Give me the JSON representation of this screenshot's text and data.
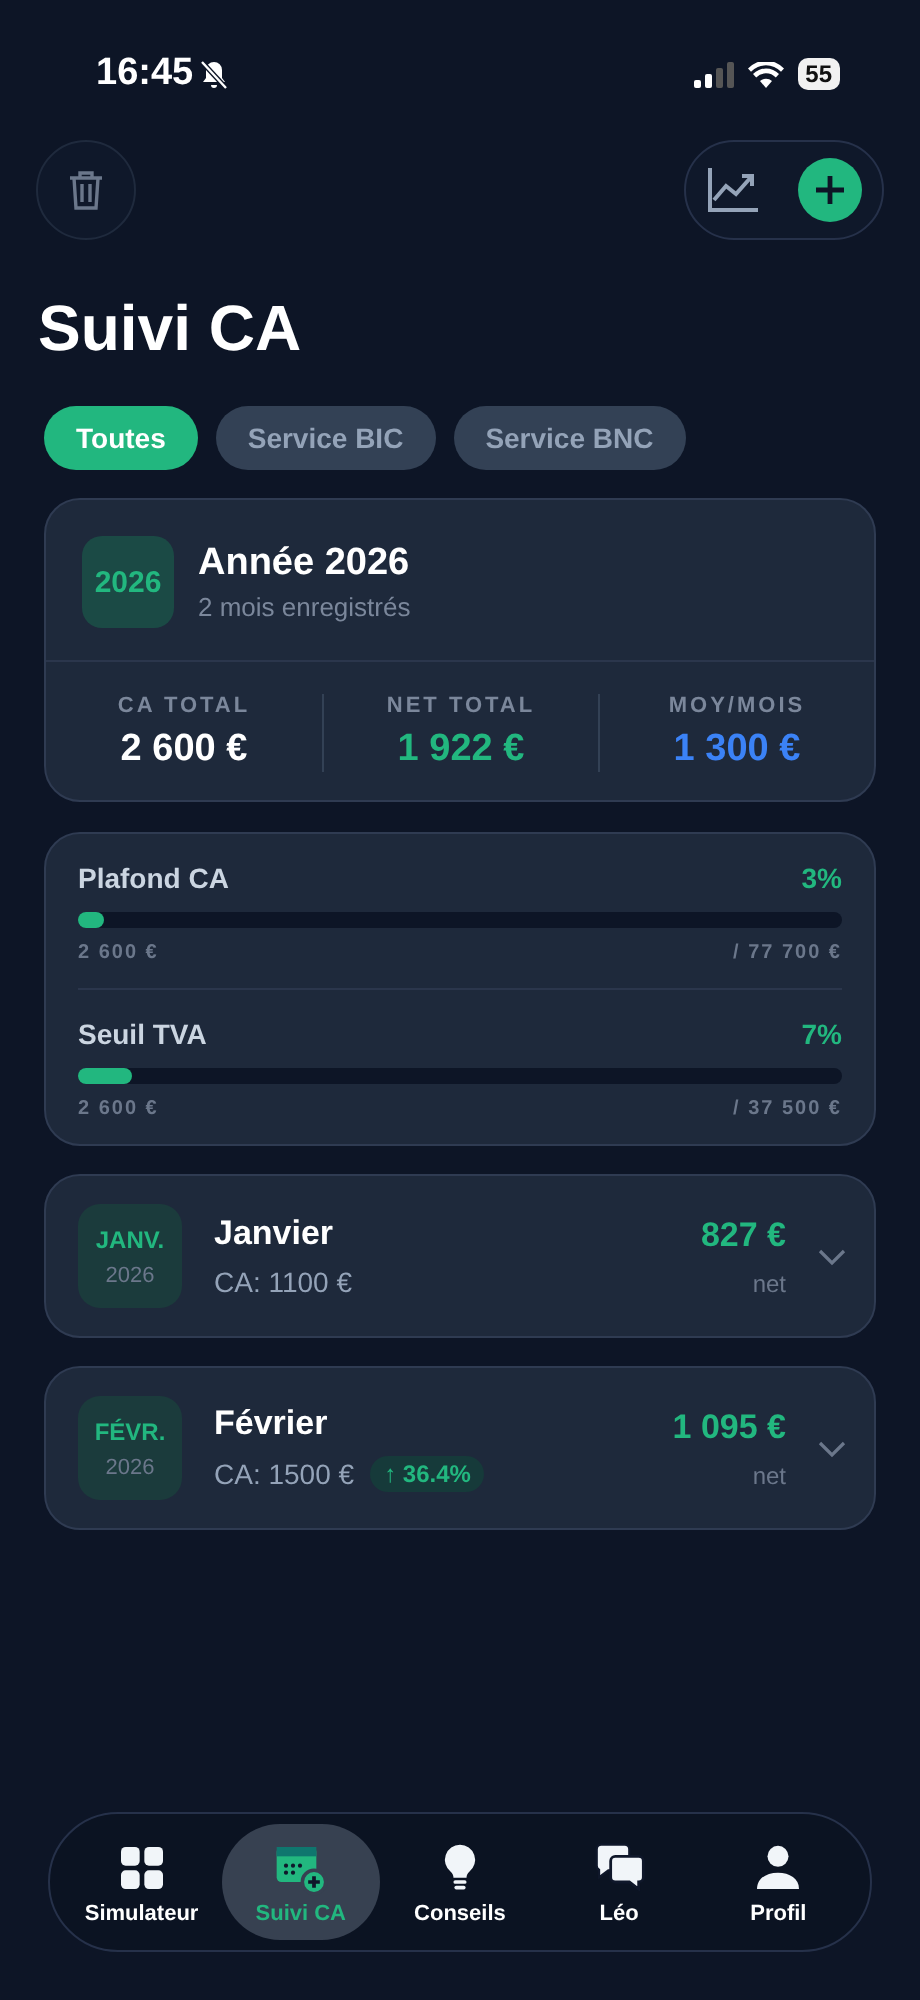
{
  "status_bar": {
    "time": "16:45",
    "battery": "55"
  },
  "title": "Suivi CA",
  "filters": [
    {
      "label": "Toutes",
      "selected": true
    },
    {
      "label": "Service BIC",
      "selected": false
    },
    {
      "label": "Service BNC",
      "selected": false
    }
  ],
  "year_card": {
    "badge": "2026",
    "title": "Année 2026",
    "subtitle": "2 mois enregistrés",
    "stats": [
      {
        "label": "CA TOTAL",
        "value": "2 600 €",
        "color": "#ffffff"
      },
      {
        "label": "NET TOTAL",
        "value": "1 922 €",
        "color": "#22b77f"
      },
      {
        "label": "MOY/MOIS",
        "value": "1 300 €",
        "color": "#3b82f6"
      }
    ]
  },
  "limits": [
    {
      "label": "Plafond CA",
      "percent": "3%",
      "level": 0.03,
      "current": "2 600 €",
      "max": "/ 77 700 €"
    },
    {
      "label": "Seuil TVA",
      "percent": "7%",
      "level": 0.07,
      "current": "2 600 €",
      "max": "/ 37 500 €"
    }
  ],
  "months": [
    {
      "abbr": "JANV.",
      "year": "2026",
      "name": "Janvier",
      "ca": "CA: 1100 €",
      "net": "827 €",
      "net_label": "net",
      "expanded": false
    },
    {
      "abbr": "FÉVR.",
      "year": "2026",
      "name": "Février",
      "ca": "CA: 1500 €",
      "growth": "↑ 36.4%",
      "net": "1 095 €",
      "net_label": "net",
      "expanded": false
    }
  ],
  "tab_bar": [
    {
      "label": "Simulateur",
      "selected": false
    },
    {
      "label": "Suivi CA",
      "selected": true
    },
    {
      "label": "Conseils",
      "selected": false
    },
    {
      "label": "Léo",
      "selected": false
    },
    {
      "label": "Profil",
      "selected": false
    }
  ]
}
